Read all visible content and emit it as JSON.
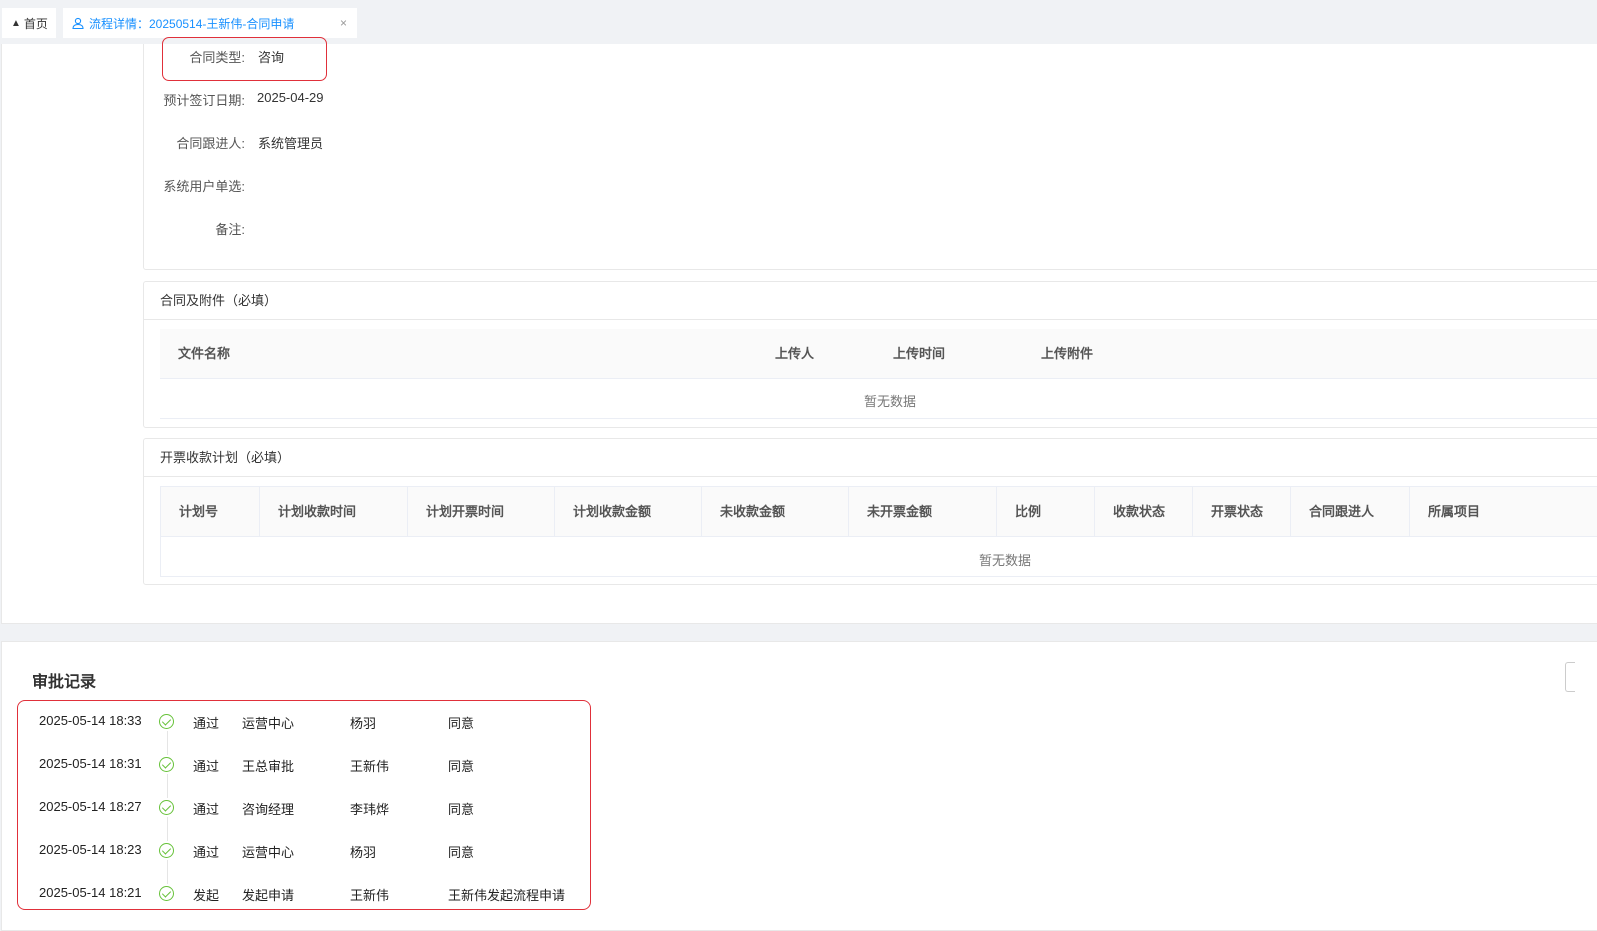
{
  "tabs": {
    "home_label": "首页",
    "active_label": "流程详情：20250514-王新伟-合同申请",
    "close_glyph": "×"
  },
  "form": {
    "contract_type_label": "合同类型:",
    "contract_type_value": "咨询",
    "sign_date_label": "预计签订日期:",
    "sign_date_value": "2025-04-29",
    "follower_label": "合同跟进人:",
    "follower_value": "系统管理员",
    "user_select_label": "系统用户单选:",
    "remark_label": "备注:"
  },
  "attachments": {
    "title": "合同及附件（必填）",
    "columns": [
      "文件名称",
      "上传人",
      "上传时间",
      "上传附件"
    ],
    "empty_text": "暂无数据"
  },
  "invoice_plan": {
    "title": "开票收款计划（必填）",
    "columns": [
      "计划号",
      "计划收款时间",
      "计划开票时间",
      "计划收款金额",
      "未收款金额",
      "未开票金额",
      "比例",
      "收款状态",
      "开票状态",
      "合同跟进人",
      "所属项目"
    ],
    "empty_text": "暂无数据"
  },
  "approval": {
    "title": "审批记录",
    "records": [
      {
        "time": "2025-05-14 18:33",
        "action": "通过",
        "node": "运营中心",
        "person": "杨羽",
        "comment": "同意"
      },
      {
        "time": "2025-05-14 18:31",
        "action": "通过",
        "node": "王总审批",
        "person": "王新伟",
        "comment": "同意"
      },
      {
        "time": "2025-05-14 18:27",
        "action": "通过",
        "node": "咨询经理",
        "person": "李玮烨",
        "comment": "同意"
      },
      {
        "time": "2025-05-14 18:23",
        "action": "通过",
        "node": "运营中心",
        "person": "杨羽",
        "comment": "同意"
      },
      {
        "time": "2025-05-14 18:21",
        "action": "发起",
        "node": "发起申请",
        "person": "王新伟",
        "comment": "王新伟发起流程申请"
      }
    ]
  },
  "colors": {
    "accent": "#1890ff",
    "highlight": "#e0303a",
    "success": "#67c23a"
  }
}
